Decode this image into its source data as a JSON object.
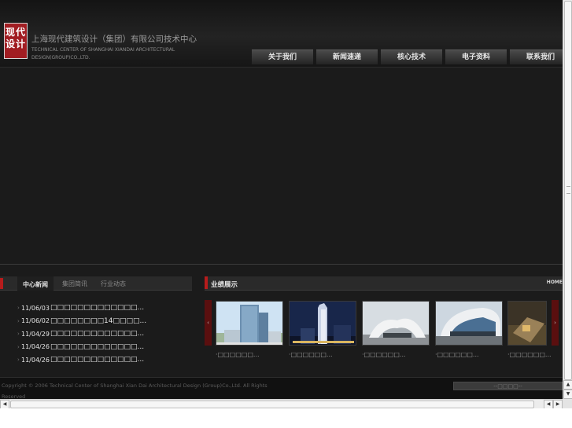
{
  "header": {
    "logo_top": "现代",
    "logo_bottom": "设计",
    "company_cn": "上海现代建筑设计（集团）有限公司技术中心",
    "company_en": "TECHNICAL CENTER OF SHANGHAI XIANDAI ARCHITECTURAL DESIGN(GROUP)CO.,LTD."
  },
  "nav": [
    "关于我们",
    "新闻速递",
    "核心技术",
    "电子资料",
    "联系我们"
  ],
  "news": {
    "tabs": [
      "中心新闻",
      "集团简讯",
      "行业动态"
    ],
    "items": [
      {
        "date": "11/06/03",
        "title": "□□□□□□□□□□□□□..."
      },
      {
        "date": "11/06/02",
        "title": "□□□□□□□□14□□□□..."
      },
      {
        "date": "11/04/29",
        "title": "□□□□□□□□□□□□□..."
      },
      {
        "date": "11/04/26",
        "title": "□□□□□□□□□□□□□..."
      },
      {
        "date": "11/04/26",
        "title": "□□□□□□□□□□□□□..."
      }
    ]
  },
  "projects": {
    "title": "业绩展示",
    "more": "HOME",
    "captions": [
      "·□□□□□□...",
      "·□□□□□□...",
      "·□□□□□□...",
      "·□□□□□□...",
      "·□□□□□□..."
    ]
  },
  "footer": {
    "copyright": "Copyright © 2006 Technical Center of Shanghai Xian Dai Architectural Design (Group)Co.,Ltd. All Rights Reserved",
    "select": "--□□□□--"
  },
  "colors": {
    "accent": "#b71c1c",
    "background": "#1b1b1b"
  }
}
